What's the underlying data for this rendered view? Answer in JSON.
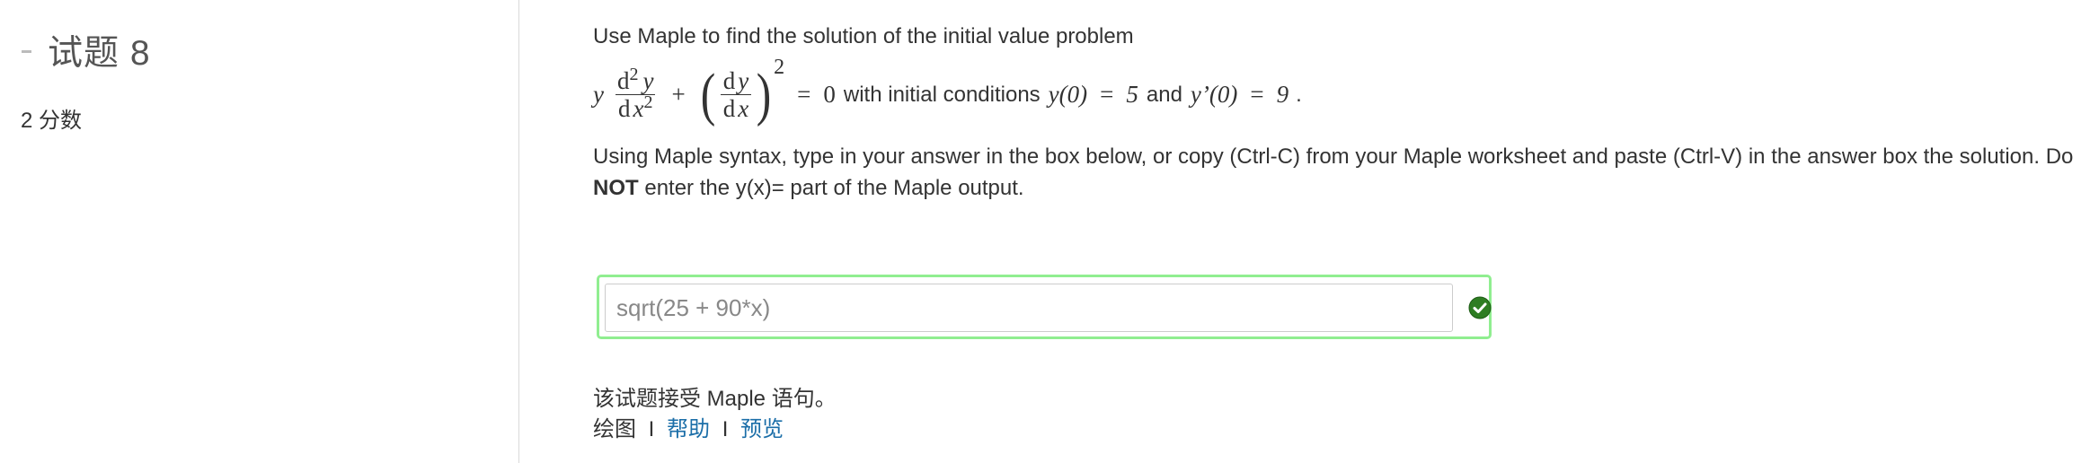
{
  "sidebar": {
    "dash": "-",
    "question_title": "试题 8",
    "score": "2 分数"
  },
  "question": {
    "intro": "Use Maple to find the solution of the initial value problem",
    "equation": {
      "y": "y",
      "d": "d",
      "x": "x",
      "exp2": "2",
      "plus": "+",
      "equals": "=",
      "zero": "0",
      "with_text": "with initial conditions",
      "cond1_lhs": "y(0)",
      "cond1_rhs": "5",
      "and_text": "and",
      "cond2_lhs": "y’(0)",
      "cond2_rhs": "9",
      "period": "."
    },
    "instructions_1": "Using Maple syntax, type in your answer in the box below, or copy (Ctrl-C) from your Maple worksheet and paste (Ctrl-V) in the answer box the solution. Do",
    "instructions_bold": "NOT",
    "instructions_2": "enter the y(x)= part of the Maple output."
  },
  "answer": {
    "value": "sqrt(25 + 90*x)",
    "status": "correct",
    "status_color": "#2e7d22",
    "border_color": "#90ee90"
  },
  "footer": {
    "accepts_text": "该试题接受 Maple 语句。",
    "plot_label": "绘图",
    "separator": "I",
    "help_link": "帮助",
    "preview_link": "预览"
  },
  "colors": {
    "link": "#1b6ea8",
    "text": "#333333"
  }
}
